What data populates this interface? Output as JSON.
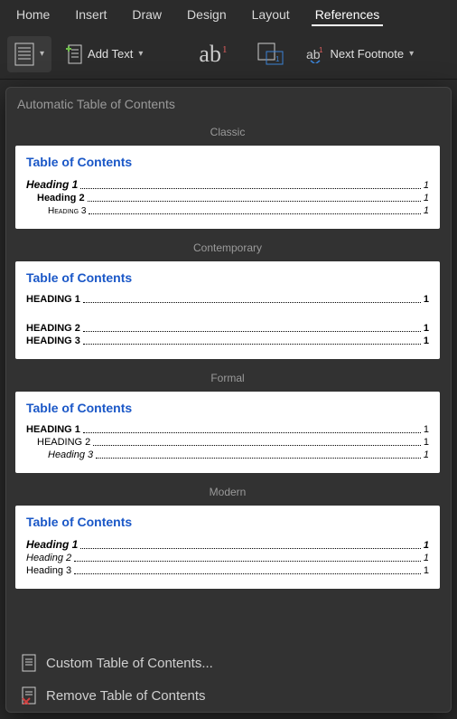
{
  "tabs": {
    "home": "Home",
    "insert": "Insert",
    "draw": "Draw",
    "design": "Design",
    "layout": "Layout",
    "references": "References"
  },
  "ribbon": {
    "add_text": "Add Text",
    "next_footnote": "Next Footnote"
  },
  "panel": {
    "header": "Automatic Table of Contents",
    "styles": {
      "classic": "Classic",
      "contemporary": "Contemporary",
      "formal": "Formal",
      "modern": "Modern"
    },
    "toc_title": "Table of Contents",
    "headings": {
      "h1": "Heading 1",
      "h2": "Heading 2",
      "h3": "Heading 3",
      "H1": "HEADING 1",
      "H2": "HEADING 2",
      "H3": "HEADING 3"
    },
    "page": "1"
  },
  "footer": {
    "custom": "Custom Table of Contents...",
    "remove": "Remove Table of Contents"
  }
}
